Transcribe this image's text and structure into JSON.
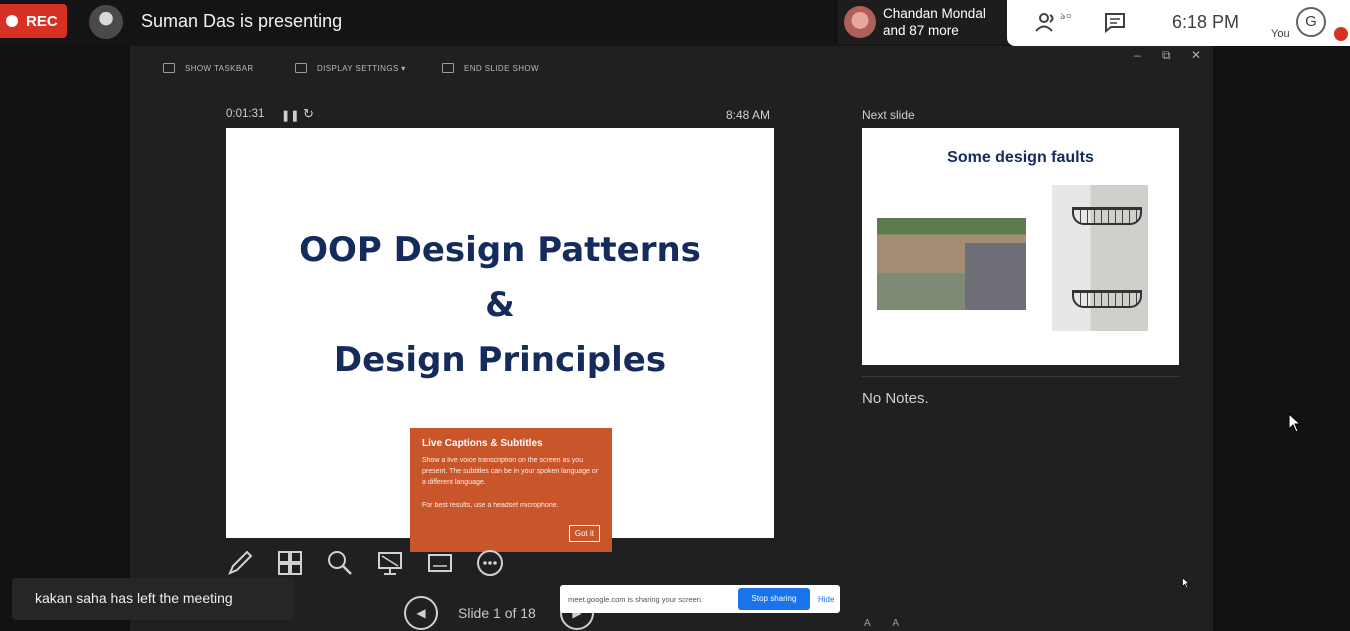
{
  "topbar": {
    "rec_label": "REC",
    "presenting_text": "Suman Das is presenting",
    "participant_name": "Chandan Mondal",
    "participant_more": "and 87 more",
    "people_count": "৯০",
    "time": "6:18 PM",
    "you_initial": "G",
    "you_label": "You"
  },
  "toolbar": {
    "show_taskbar": "SHOW TASKBAR",
    "display_settings": "DISPLAY SETTINGS ▾",
    "end_slide_show": "END SLIDE SHOW",
    "minimize": "‒",
    "restore": "⧉",
    "close": "✕"
  },
  "presenter": {
    "timer": "0:01:31",
    "clock": "8:48 AM",
    "slide_title_line1": "OOP Design Patterns",
    "slide_title_line2": "&",
    "slide_title_line3": "Design Principles",
    "slide_counter": "Slide 1 of 18",
    "next_slide_label": "Next slide",
    "next_slide_title": "Some design faults",
    "notes": "No Notes."
  },
  "captions_popup": {
    "title": "Live Captions & Subtitles",
    "body": "Show a live voice transcription on the screen as you present. The subtitles can be in your spoken language or a different language.",
    "tip": "For best results, use a headset microphone.",
    "button": "Got it"
  },
  "toast": {
    "text": "kakan saha has left the meeting"
  },
  "share_bar": {
    "text": "meet.google.com is sharing your screen.",
    "stop_label": "Stop sharing",
    "hide_label": "Hide"
  },
  "colors": {
    "rec_red": "#d93025",
    "slide_title_navy": "#142b5c",
    "popup_orange": "#c9562a",
    "stop_blue": "#1a73e8"
  },
  "icons": [
    "pencil-icon",
    "slide-grid-icon",
    "zoom-icon",
    "screen-icon",
    "subtitle-icon",
    "more-icon",
    "prev-icon",
    "next-icon",
    "people-icon",
    "chat-icon",
    "mic-off-icon"
  ]
}
